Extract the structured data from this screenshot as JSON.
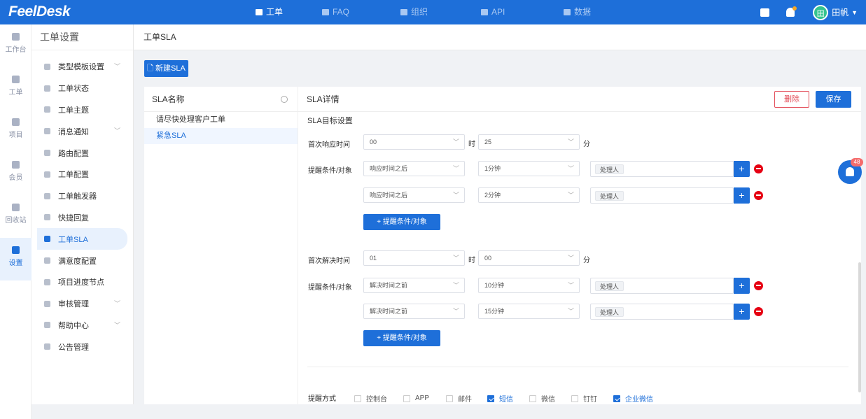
{
  "brand": {
    "logo": "FeelDesk",
    "accent": "#1e6fd9"
  },
  "topnav": [
    {
      "label": "工单",
      "icon": "ticket-icon",
      "active": true
    },
    {
      "label": "FAQ",
      "icon": "faq-icon",
      "active": false
    },
    {
      "label": "组织",
      "icon": "org-icon",
      "active": false
    },
    {
      "label": "API",
      "icon": "api-icon",
      "active": false
    },
    {
      "label": "数据",
      "icon": "chart-icon",
      "active": false
    }
  ],
  "user": {
    "avatar": "田",
    "name": "田帆"
  },
  "leftnav": [
    {
      "label": "工作台",
      "icon": "dashboard-icon"
    },
    {
      "label": "工单",
      "icon": "ticket-icon"
    },
    {
      "label": "项目",
      "icon": "folder-icon"
    },
    {
      "label": "会员",
      "icon": "member-icon"
    },
    {
      "label": "回收站",
      "icon": "trash-icon"
    },
    {
      "label": "设置",
      "icon": "wrench-icon",
      "active": true
    }
  ],
  "sidebar": {
    "title": "工单设置",
    "items": [
      {
        "label": "类型模板设置",
        "expandable": true
      },
      {
        "label": "工单状态"
      },
      {
        "label": "工单主题"
      },
      {
        "label": "消息通知",
        "expandable": true
      },
      {
        "label": "路由配置"
      },
      {
        "label": "工单配置"
      },
      {
        "label": "工单触发器"
      },
      {
        "label": "快捷回复"
      },
      {
        "label": "工单SLA",
        "active": true
      },
      {
        "label": "满意度配置"
      },
      {
        "label": "项目进度节点"
      },
      {
        "label": "审核管理",
        "expandable": true
      },
      {
        "label": "帮助中心",
        "expandable": true
      },
      {
        "label": "公告管理"
      }
    ]
  },
  "breadcrumb": "工单SLA",
  "new_button": "新建SLA",
  "list": {
    "header": "SLA名称",
    "items": [
      {
        "label": "请尽快处理客户工单"
      },
      {
        "label": "紧急SLA",
        "active": true
      }
    ]
  },
  "detail": {
    "header": "SLA详情",
    "delete_label": "删除",
    "save_label": "保存",
    "section_title": "SLA目标设置",
    "hour_unit": "时",
    "minute_unit": "分",
    "remind_label": "提醒条件/对象",
    "add_label": "+ 提醒条件/对象",
    "first_response": {
      "label": "首次响应时间",
      "hours": "00",
      "minutes": "25",
      "reminders": [
        {
          "condition": "响应时间之后",
          "time": "1分钟",
          "target": "处理人"
        },
        {
          "condition": "响应时间之后",
          "time": "2分钟",
          "target": "处理人"
        }
      ]
    },
    "first_resolve": {
      "label": "首次解决时间",
      "hours": "01",
      "minutes": "00",
      "reminders": [
        {
          "condition": "解决时间之前",
          "time": "10分钟",
          "target": "处理人"
        },
        {
          "condition": "解决时间之前",
          "time": "15分钟",
          "target": "处理人"
        }
      ]
    },
    "notify": {
      "label": "提醒方式",
      "options": [
        {
          "label": "控制台",
          "checked": false
        },
        {
          "label": "APP",
          "checked": false
        },
        {
          "label": "邮件",
          "checked": false
        },
        {
          "label": "短信",
          "checked": true
        },
        {
          "label": "微信",
          "checked": false
        },
        {
          "label": "钉钉",
          "checked": false
        },
        {
          "label": "企业微信",
          "checked": true
        }
      ]
    }
  },
  "float_badge": "48"
}
